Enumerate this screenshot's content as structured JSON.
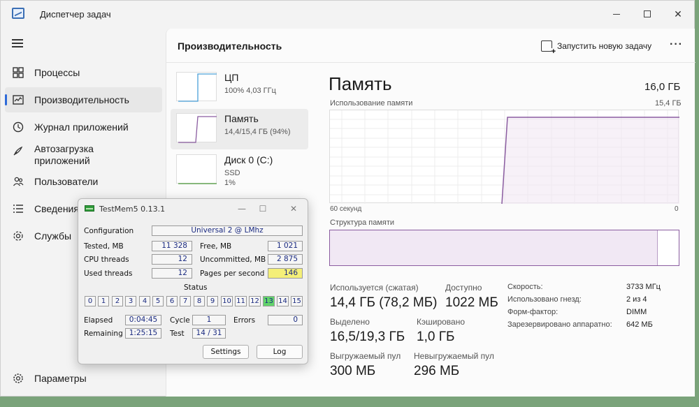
{
  "window": {
    "title": "Диспетчер задач"
  },
  "sidebar": {
    "items": [
      {
        "label": "Процессы",
        "icon": "processes-icon"
      },
      {
        "label": "Производительность",
        "icon": "performance-icon"
      },
      {
        "label": "Журнал приложений",
        "icon": "history-icon"
      },
      {
        "label": "Автозагрузка приложений",
        "icon": "startup-icon"
      },
      {
        "label": "Пользователи",
        "icon": "users-icon"
      },
      {
        "label": "Сведения",
        "icon": "details-icon"
      },
      {
        "label": "Службы",
        "icon": "services-icon"
      }
    ],
    "settings_label": "Параметры"
  },
  "header": {
    "title": "Производительность",
    "run_task_label": "Запустить новую задачу",
    "more_label": "···"
  },
  "devices": [
    {
      "name": "ЦП",
      "sub": "100%  4,03 ГГц",
      "sub2": "",
      "color": "#4aa0d8"
    },
    {
      "name": "Память",
      "sub": "14,4/15,4 ГБ (94%)",
      "sub2": "",
      "color": "#8a5ca0"
    },
    {
      "name": "Диск 0 (C:)",
      "sub": "SSD",
      "sub2": "1%",
      "color": "#4d9a3a"
    }
  ],
  "memory": {
    "title": "Память",
    "total": "16,0 ГБ",
    "usage_label": "Использование памяти",
    "usage_max": "15,4 ГБ",
    "axis_left": "60 секунд",
    "axis_right": "0",
    "structure_label": "Структура памяти",
    "structure_used_fraction": 0.94,
    "stats": {
      "in_use_label": "Используется (сжатая)",
      "in_use_value": "14,4 ГБ (78,2 МБ)",
      "available_label": "Доступно",
      "available_value": "1022 МБ",
      "committed_label": "Выделено",
      "committed_value": "16,5/19,3 ГБ",
      "cached_label": "Кэшировано",
      "cached_value": "1,0 ГБ",
      "paged_label": "Выгружаемый пул",
      "paged_value": "300 МБ",
      "nonpaged_label": "Невыгружаемый пул",
      "nonpaged_value": "296 МБ"
    },
    "specs": [
      {
        "label": "Скорость:",
        "value": "3733 МГц"
      },
      {
        "label": "Использовано гнезд:",
        "value": "2 из 4"
      },
      {
        "label": "Форм-фактор:",
        "value": "DIMM"
      },
      {
        "label": "Зарезервировано аппаратно:",
        "value": "642 МБ"
      }
    ],
    "accent": "#8a5ca0"
  },
  "testmem": {
    "title": "TestMem5  0.13.1",
    "configuration_label": "Configuration",
    "configuration_value": "Universal 2 @ LMhz",
    "tested_label": "Tested, MB",
    "tested_value": "11 328",
    "free_label": "Free, MB",
    "free_value": "1 021",
    "cpu_threads_label": "CPU threads",
    "cpu_threads_value": "12",
    "uncommitted_label": "Uncommitted, MB",
    "uncommitted_value": "2 875",
    "used_threads_label": "Used threads",
    "used_threads_value": "12",
    "pages_label": "Pages per second",
    "pages_value": "146",
    "status_label": "Status",
    "status_numbers": [
      "0",
      "1",
      "2",
      "3",
      "4",
      "5",
      "6",
      "7",
      "8",
      "9",
      "10",
      "11",
      "12",
      "13",
      "14",
      "15"
    ],
    "status_active": "13",
    "elapsed_label": "Elapsed",
    "elapsed_value": "0:04:45",
    "cycle_label": "Cycle",
    "cycle_value": "1",
    "errors_label": "Errors",
    "errors_value": "0",
    "remaining_label": "Remaining",
    "remaining_value": "1:25:15",
    "test_label": "Test",
    "test_value": "14 / 31",
    "settings_button": "Settings",
    "log_button": "Log"
  }
}
